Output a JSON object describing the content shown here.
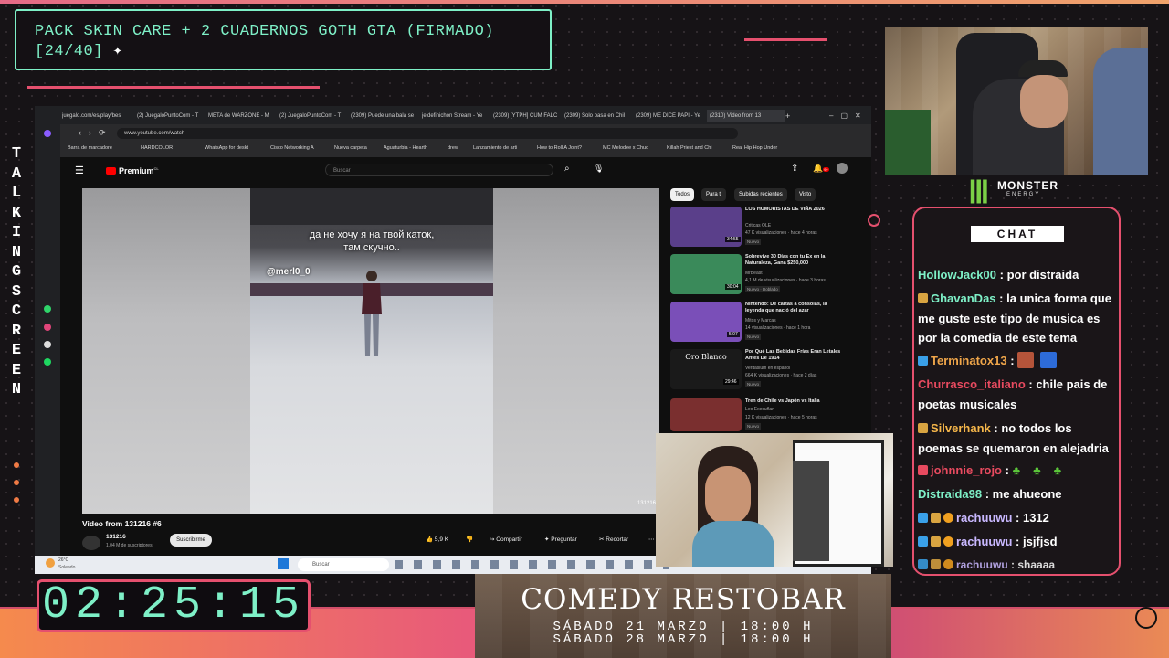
{
  "goal": {
    "line1": "PACK SKIN CARE + 2 CUADERNOS GOTH GTA (FIRMADO)",
    "line2": "[24/40]",
    "icon": "sparkle-icon"
  },
  "side_text": "TALKING SCREEN",
  "timer": "02:25:15",
  "browser": {
    "tabs": [
      "juegalo.com/es/play/bes",
      "(2) JuegaloPuntoCom - T",
      "META de WARZONE - M",
      "(2) JuegaloPuntoCom - T",
      "(2309) Puede una bala se",
      "jeidefinichon Stream - Ye",
      "(2309) [YTPH] CUM FALC",
      "(2309) Solo pasa en Chil",
      "(2309) ME DICE PAPI - Ye",
      "(2310) Video from 13"
    ],
    "url": "www.youtube.com/watch",
    "bookmarks": [
      "Barra de marcadore",
      "HARDCOLOR",
      "WhatsApp for deskt",
      "Cisco Networking A",
      "Nueva carpeta",
      "Aguaturbia - Hearth",
      "drew",
      "Lanzamiento de arti",
      "How to Roll A Joint?",
      "MC Melodee x Chuc",
      "Killah Priest and Chi",
      "Real Hip Hop Under"
    ]
  },
  "youtube": {
    "logo": "Premium",
    "logo_sup": "CL",
    "search_placeholder": "Buscar",
    "notif_count": "9+",
    "subtitle_line1": "да не хочу я на твой каток,",
    "subtitle_line2": "там скучно..",
    "watermark": "@merl0_0",
    "corner_mark": "131216",
    "video_title": "Video from 131216 #6",
    "channel": "131216",
    "subs": "1,04 M de suscriptores",
    "subscribe": "Suscribirme",
    "likes": "5,9 K",
    "share": "Compartir",
    "ask": "Preguntar",
    "clip": "Recortar",
    "chips": [
      "Todos",
      "Para ti",
      "Subidas recientes",
      "Visto"
    ],
    "recs": [
      {
        "title": "LOS HUMORISTAS DE VIÑA 2026",
        "channel": "Criticas OLE",
        "views": "47 K visualizaciones · hace 4 horas",
        "badge": "Nuevo",
        "dur": "34:55",
        "thumb_color": "#5a3f8a"
      },
      {
        "title": "Sobrevive 30 Días con tu Ex en la Naturaleza, Gana $250,000",
        "channel": "MrBeast",
        "views": "4,1 M de visualizaciones · hace 3 horas",
        "badge": "Nuevo",
        "badge2": "Doblado",
        "dur": "30:04",
        "thumb_color": "#3a8a5a"
      },
      {
        "title": "Nintendo: De cartas a consolas, la leyenda que nació del azar",
        "channel": "Mitos y Marcas",
        "views": "14 visualizaciones · hace 1 hora",
        "badge": "Nuevo",
        "dur": "5:07",
        "thumb_color": "#7a4fb8"
      },
      {
        "title": "Por Qué Las Bebidas Frías Eran Letales Antes De 1914",
        "channel": "Veritasium en español",
        "views": "664 K visualizaciones · hace 2 días",
        "badge": "Nuevo",
        "dur": "29:46",
        "thumb_color": "#1a1a1a",
        "thumb_text": "Oro Blanco"
      },
      {
        "title": "Tren de Chile vs Japón vs Italia",
        "channel": "Leo Execuñan",
        "views": "12 K visualizaciones · hace 5 horas",
        "badge": "Nuevo",
        "dur": "",
        "thumb_color": "#7a2f2f"
      }
    ]
  },
  "taskbar": {
    "temp": "26°C",
    "weather": "Soleado",
    "search": "Buscar"
  },
  "chat": {
    "title": "CHAT",
    "messages": [
      {
        "user": "HollowJack00",
        "user_color": "#7ef0c7",
        "text": ": por distraida",
        "badges": []
      },
      {
        "user": "GhavanDas",
        "user_color": "#7ef0c7",
        "text": ": la unica forma que me guste este tipo de musica es por la comedia de este tema",
        "badges": [
          "#d9a441"
        ]
      },
      {
        "user": "Terminatox13",
        "user_color": "#f0a64a",
        "text": ":",
        "badges": [
          "#3aa0e8"
        ]
      },
      {
        "user": "Churrasco_italiano",
        "user_color": "#e84a5f",
        "text": ": chile pais de poetas musicales",
        "badges": []
      },
      {
        "user": "Silverhank",
        "user_color": "#f5b64a",
        "text": ": no todos los poemas se quemaron en alejadria",
        "badges": [
          "#d9a441"
        ]
      },
      {
        "user": "johnnie_rojo",
        "user_color": "#e84a5f",
        "text": ":",
        "badges": [
          "#e84a5f"
        ]
      },
      {
        "user": "Distraida98",
        "user_color": "#7ef0c7",
        "text": ": me ahueone",
        "badges": []
      },
      {
        "user": "rachuuwu",
        "user_color": "#c9b8ff",
        "text": ": 1312",
        "badges": [
          "#3aa0e8",
          "#d9a441",
          "#f0a020"
        ]
      },
      {
        "user": "rachuuwu",
        "user_color": "#c9b8ff",
        "text": ": jsjfjsd",
        "badges": [
          "#3aa0e8",
          "#d9a441",
          "#f0a020"
        ]
      },
      {
        "user": "rachuuwu",
        "user_color": "#c9b8ff",
        "text": ": shaaaa",
        "badges": [
          "#3aa0e8",
          "#d9a441",
          "#f0a020"
        ]
      }
    ]
  },
  "monster": {
    "brand": "MONSTER",
    "sub": "ENERGY"
  },
  "banner": {
    "title": "COMEDY RESTOBAR",
    "line1": "SÁBADO 21 MARZO | 18:00 H",
    "line2": "SÁBADO 28 MARZO | 18:00 H"
  },
  "colors": {
    "accent_green": "#7ef0c7",
    "accent_pink": "#e5506e",
    "orange": "#f07b45"
  }
}
